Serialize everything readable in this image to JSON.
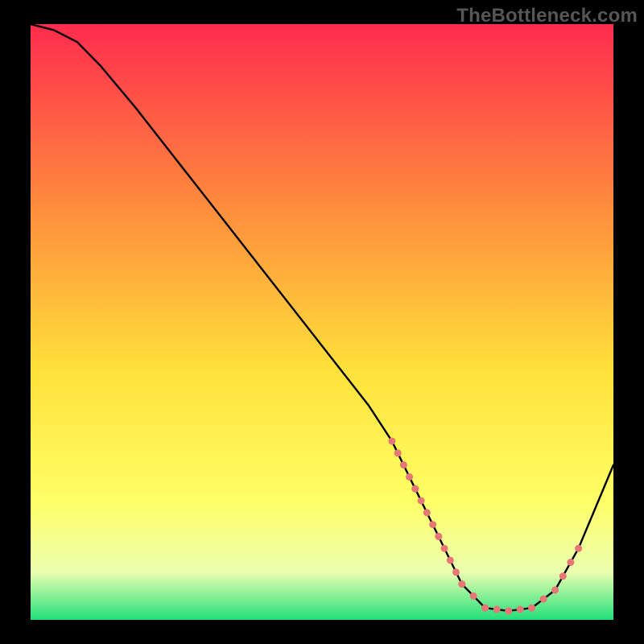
{
  "watermark": "TheBottleneck.com",
  "gradient": {
    "top": "#ff2b4e",
    "mid1": "#ff8a3c",
    "mid2": "#ffe13a",
    "mid3": "#ffff66",
    "mid4": "#eaffb0",
    "bottom": "#22e07a"
  },
  "chart_data": {
    "type": "line",
    "title": "",
    "xlabel": "",
    "ylabel": "",
    "xlim": [
      0,
      100
    ],
    "ylim": [
      0,
      100
    ],
    "series": [
      {
        "name": "curve",
        "x": [
          0,
          4,
          8,
          12,
          18,
          26,
          34,
          42,
          50,
          58,
          62,
          66,
          70,
          74,
          78,
          82,
          86,
          90,
          94,
          100
        ],
        "values": [
          100,
          99,
          97,
          93,
          86,
          76,
          66,
          56,
          46,
          36,
          30,
          22,
          14,
          6,
          2,
          1.5,
          2,
          5,
          12,
          26
        ]
      }
    ],
    "dotted_segments": [
      {
        "x": [
          62,
          66,
          70,
          74,
          78
        ],
        "y": [
          30,
          22,
          14,
          6,
          2
        ]
      },
      {
        "x": [
          78,
          82,
          86,
          90
        ],
        "y": [
          2,
          1.5,
          2,
          5
        ]
      },
      {
        "x": [
          90,
          94
        ],
        "y": [
          5,
          12
        ]
      }
    ],
    "dot_color": "#e77676",
    "dot_radius": 4.5
  }
}
